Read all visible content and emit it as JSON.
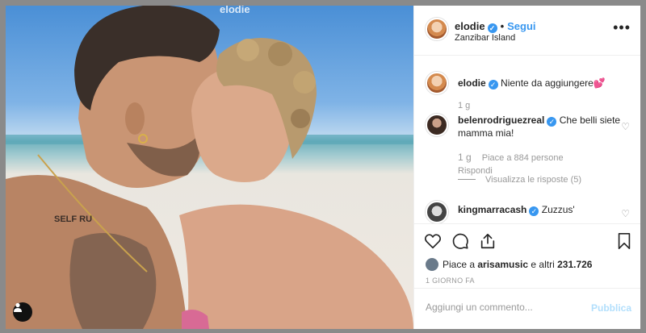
{
  "photo": {
    "ghost_username": "elodie"
  },
  "header": {
    "username": "elodie",
    "separator": "•",
    "follow_label": "Segui",
    "location": "Zanzibar Island",
    "more_icon": "more-dots-icon"
  },
  "caption": {
    "username": "elodie",
    "text": "Niente da aggiungere💕",
    "time": "1 g"
  },
  "comments": [
    {
      "username": "belenrodriguezreal",
      "text": "Che belli siete mamma mia!",
      "time": "1 g",
      "likes": "Piace a 884 persone",
      "reply": "Rispondi",
      "view_replies": "Visualizza le risposte (5)"
    },
    {
      "username": "kingmarracash",
      "text": "Zuzzus'"
    }
  ],
  "likes": {
    "prefix": "Piace a ",
    "user": "arisamusic",
    "mid": " e altri ",
    "count": "231.726"
  },
  "timestamp": "1 GIORNO FA",
  "add_comment": {
    "placeholder": "Aggiungi un commento...",
    "publish_label": "Pubblica"
  },
  "colors": {
    "accent": "#3897f0",
    "publish_disabled": "#b2dffc",
    "text": "#262626",
    "muted": "#999999"
  }
}
